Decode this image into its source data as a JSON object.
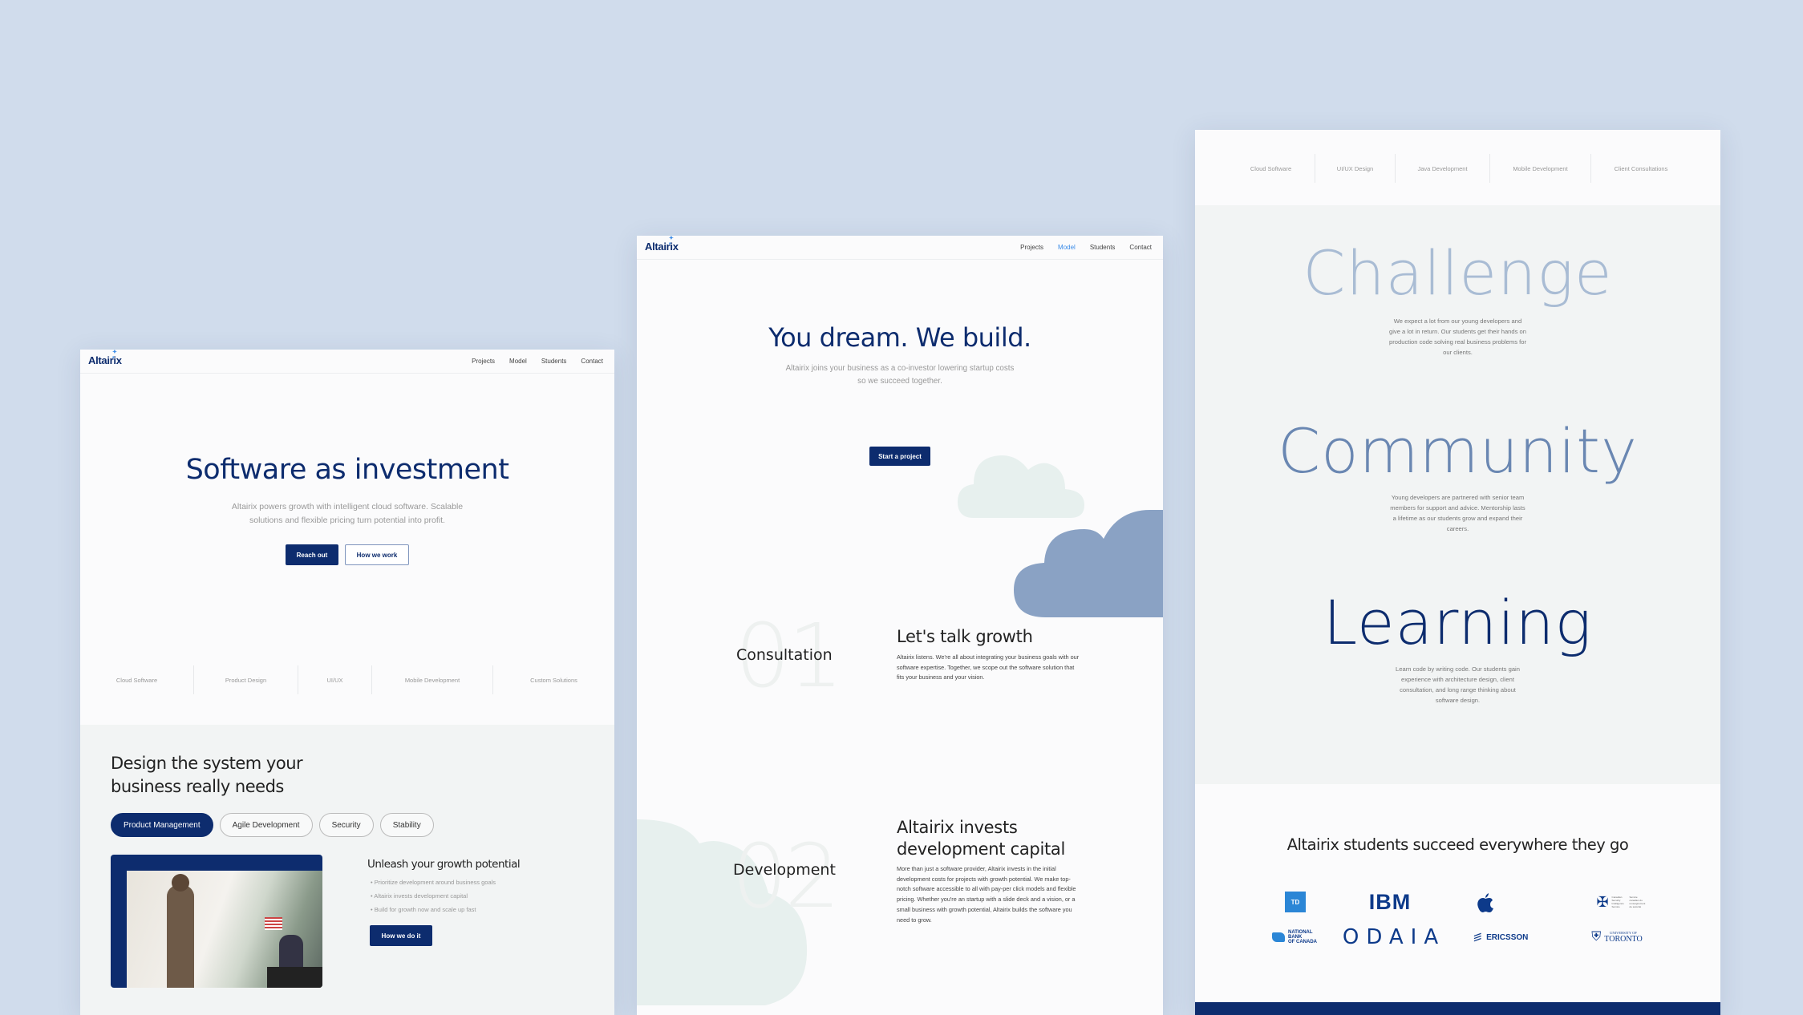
{
  "background_color": "#d0dcec",
  "brand": {
    "name": "Altairix",
    "primary": "#0d2c6e",
    "accent": "#3a8be8",
    "cloud_dark": "#8aa2c4",
    "cloud_light": "#e7f0ee"
  },
  "panel1": {
    "nav": {
      "logo": "Altairix",
      "links": [
        "Projects",
        "Model",
        "Students",
        "Contact"
      ]
    },
    "hero": {
      "title": "Software as investment",
      "subtitle_line1": "Altairix powers growth with intelligent cloud software. Scalable",
      "subtitle_line2": "solutions and flexible pricing turn potential into profit.",
      "primary_button": "Reach out",
      "secondary_button": "How we work"
    },
    "services": [
      "Cloud Software",
      "Product Design",
      "UI/UX",
      "Mobile Development",
      "Custom Solutions"
    ],
    "design_section": {
      "title_line1": "Design the system your",
      "title_line2": "business really needs",
      "tabs": [
        {
          "label": "Product Management",
          "active": true
        },
        {
          "label": "Agile Development",
          "active": false
        },
        {
          "label": "Security",
          "active": false
        },
        {
          "label": "Stability",
          "active": false
        }
      ],
      "feature_title": "Unleash your growth potential",
      "bullets": [
        "Prioritize development around business goals",
        "Altairix invests development capital",
        "Build for growth now and scale up fast"
      ],
      "button": "How we do it"
    }
  },
  "panel2": {
    "nav": {
      "logo": "Altairix",
      "links": [
        "Projects",
        "Model",
        "Students",
        "Contact"
      ],
      "active": "Model"
    },
    "hero": {
      "title": "You dream. We build.",
      "subtitle_line1": "Altairix joins your business as a co-investor lowering startup costs",
      "subtitle_line2": "so we succeed together.",
      "button": "Start a project"
    },
    "steps": [
      {
        "number": "01",
        "label": "Consultation",
        "title_line1": "Let's talk growth",
        "title_line2": "",
        "body": [
          "Altairix listens. We're all about integrating your business goals with our",
          "software expertise. Together, we scope out the software solution that",
          "fits your business and your vision."
        ]
      },
      {
        "number": "02",
        "label": "Development",
        "title_line1": "Altairix invests",
        "title_line2": "development capital",
        "body": [
          "More than just a software provider, Altairix invests in the initial",
          "development costs for projects with growth potential. We make top-",
          "notch software accessible to all with pay-per click models and flexible",
          "pricing. Whether you're an startup with a slide deck and a vision, or a",
          "small business with growth potential, Altairix builds the software you",
          "need to grow."
        ]
      }
    ]
  },
  "panel3": {
    "services": [
      "Cloud Software",
      "UI/UX Design",
      "Java Development",
      "Mobile Development",
      "Client Consultations"
    ],
    "values": [
      {
        "word": "Challenge",
        "color": "#a9bcd4",
        "desc": [
          "We expect a lot from our young developers and",
          "give a lot in return. Our students get their hands on",
          "production code solving real business problems for",
          "our clients."
        ]
      },
      {
        "word": "Community",
        "color": "#6a87b2",
        "desc": [
          "Young developers are partnered with senior team",
          "members for support and advice. Mentorship lasts",
          "a lifetime as our students grow and expand their",
          "careers."
        ]
      },
      {
        "word": "Learning",
        "color": "#0d2c6e",
        "desc": [
          "Learn code by writing code. Our students gain",
          "experience with architecture design, client",
          "consultation, and long range thinking about",
          "software design."
        ]
      }
    ],
    "partners_title": "Altairix students succeed everywhere they go",
    "partners": {
      "td": "TD",
      "ibm": "IBM",
      "apple": "",
      "csis_en": "Canadian Security Intelligence Service",
      "csis_fr": "Service canadien du renseignement de sécurité",
      "nbc": [
        "NATIONAL",
        "BANK",
        "OF CANADA"
      ],
      "odaia": "ODAIA",
      "ericsson": "ERICSSON",
      "uoft_small": "UNIVERSITY OF",
      "uoft_big": "TORONTO"
    }
  }
}
